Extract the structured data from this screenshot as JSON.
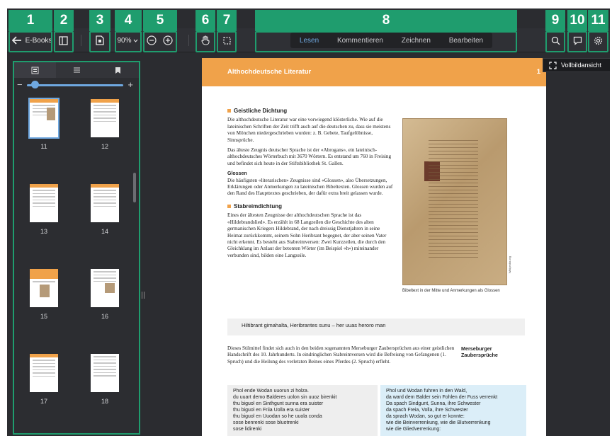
{
  "toolbar": {
    "back_label": "E-Books",
    "zoom_value": "90%",
    "modes": [
      {
        "label": "Lesen"
      },
      {
        "label": "Kommentieren"
      },
      {
        "label": "Zeichnen"
      },
      {
        "label": "Bearbeiten"
      }
    ],
    "fullscreen_label": "Vollbildansicht"
  },
  "callouts": [
    "1",
    "2",
    "3",
    "4",
    "5",
    "6",
    "7",
    "8",
    "9",
    "10",
    "11"
  ],
  "sidebar": {
    "thumbs": [
      {
        "label": "11"
      },
      {
        "label": "12"
      },
      {
        "label": "13"
      },
      {
        "label": "14"
      },
      {
        "label": "15"
      },
      {
        "label": "16"
      },
      {
        "label": "17"
      },
      {
        "label": "18"
      }
    ],
    "zoom_minus": "−",
    "zoom_plus": "+"
  },
  "page": {
    "header": "Althochdeutsche Literatur",
    "number": "1",
    "h1": "Geistliche Dichtung",
    "p1": "Die althochdeutsche Literatur war eine vorwiegend klösterliche. Wie auf die lateinischen Schriften der Zeit trifft auch auf die deutschen zu, dass sie meistens von Mönchen niedergeschrieben wurden: z. B. Gebete, Taufgelöbnisse, Sinnsprüche.",
    "p2": "Das älteste Zeugnis deutscher Sprache ist der «Abrogans», ein lateinisch-althochdeutsches Wörterbuch mit 3670 Wörtern. Es entstand um 760 in Freising und befindet sich heute in der Stiftsbibliothek St. Gallen.",
    "sub1": "Glossen",
    "p3": "Die häufigsten «literarischen» Zeugnisse sind «Glossen», also Übersetzungen, Erklärungen oder Anmerkungen zu lateinischen Bibeltexten. Glossen wurden auf den Rand des Haupttextes geschrieben, der dafür extra breit gelassen wurde.",
    "h2": "Stabreimdichtung",
    "p4": "Eines der ältesten Zeugnisse der althochdeutschen Sprache ist das «Hildebrandslied». Es erzählt in 68 Langzeilen die Geschichte des alten germanischen Kriegers Hildebrand, der nach dreissig Dienstjahren in seine Heimat zurückkommt, seinem Sohn Heribrant begegnet, der aber seinen Vater nicht erkennt. Es besteht aus Stabreimversen: Zwei Kurzzeilen, die durch den Gleichklang im Anlaut der betonten Wörter (im Beispiel «h») miteinander verbunden sind, bilden eine Langzeile.",
    "caption": "Bibeltext in der Mitte und Anmerkungen als Glossen",
    "credit": "Wikipedia.org",
    "quote": "Hiltibrant gimahalta, Heribrantes sunu – her uuas heroro man",
    "p5": "Dieses Stilmittel findet sich auch in den beiden sogenannten Merseburger Zaubersprüchen aus einer geistlichen Handschrift des 10. Jahrhunderts. In eindringlichen Stabreimversen wird die Befreiung von Gefangenen (1. Spruch) und die Heilung des verletzten Beines eines Pferdes (2. Spruch) erfleht.",
    "side_note": "Merseburger Zaubersprüche",
    "verse_left": [
      "Phol ende Wodan uuorun zi holza.",
      "du uuart demo Balderes uolon sin uuoz birenkit",
      "thu biguol en Sinthgunt sunna era suister",
      "thu biguol en Friia Uolla era suister",
      "thu biguol en Uuodan so he uuola conda",
      "sose benrenki sose bluotrenki",
      "sose lidirenki"
    ],
    "verse_right": [
      "Phol und Wodan fuhren in den Wald,",
      "da ward dem Balder sein Fohlen der Fuss verrenkt",
      "Da spach Sindgunt, Sunna, ihre Schwester",
      "da spach Freia, Volla, ihre Schwester",
      "da sprach Wodan, so gut er konnte:",
      "wie die Beinverrenkung, wie die Blutverrenkung",
      "wie die Gliedverrenkung:"
    ]
  },
  "colors": {
    "accent": "#1f9d6e",
    "page_header": "#f0a24a",
    "active_mode": "#6fa8e0"
  }
}
